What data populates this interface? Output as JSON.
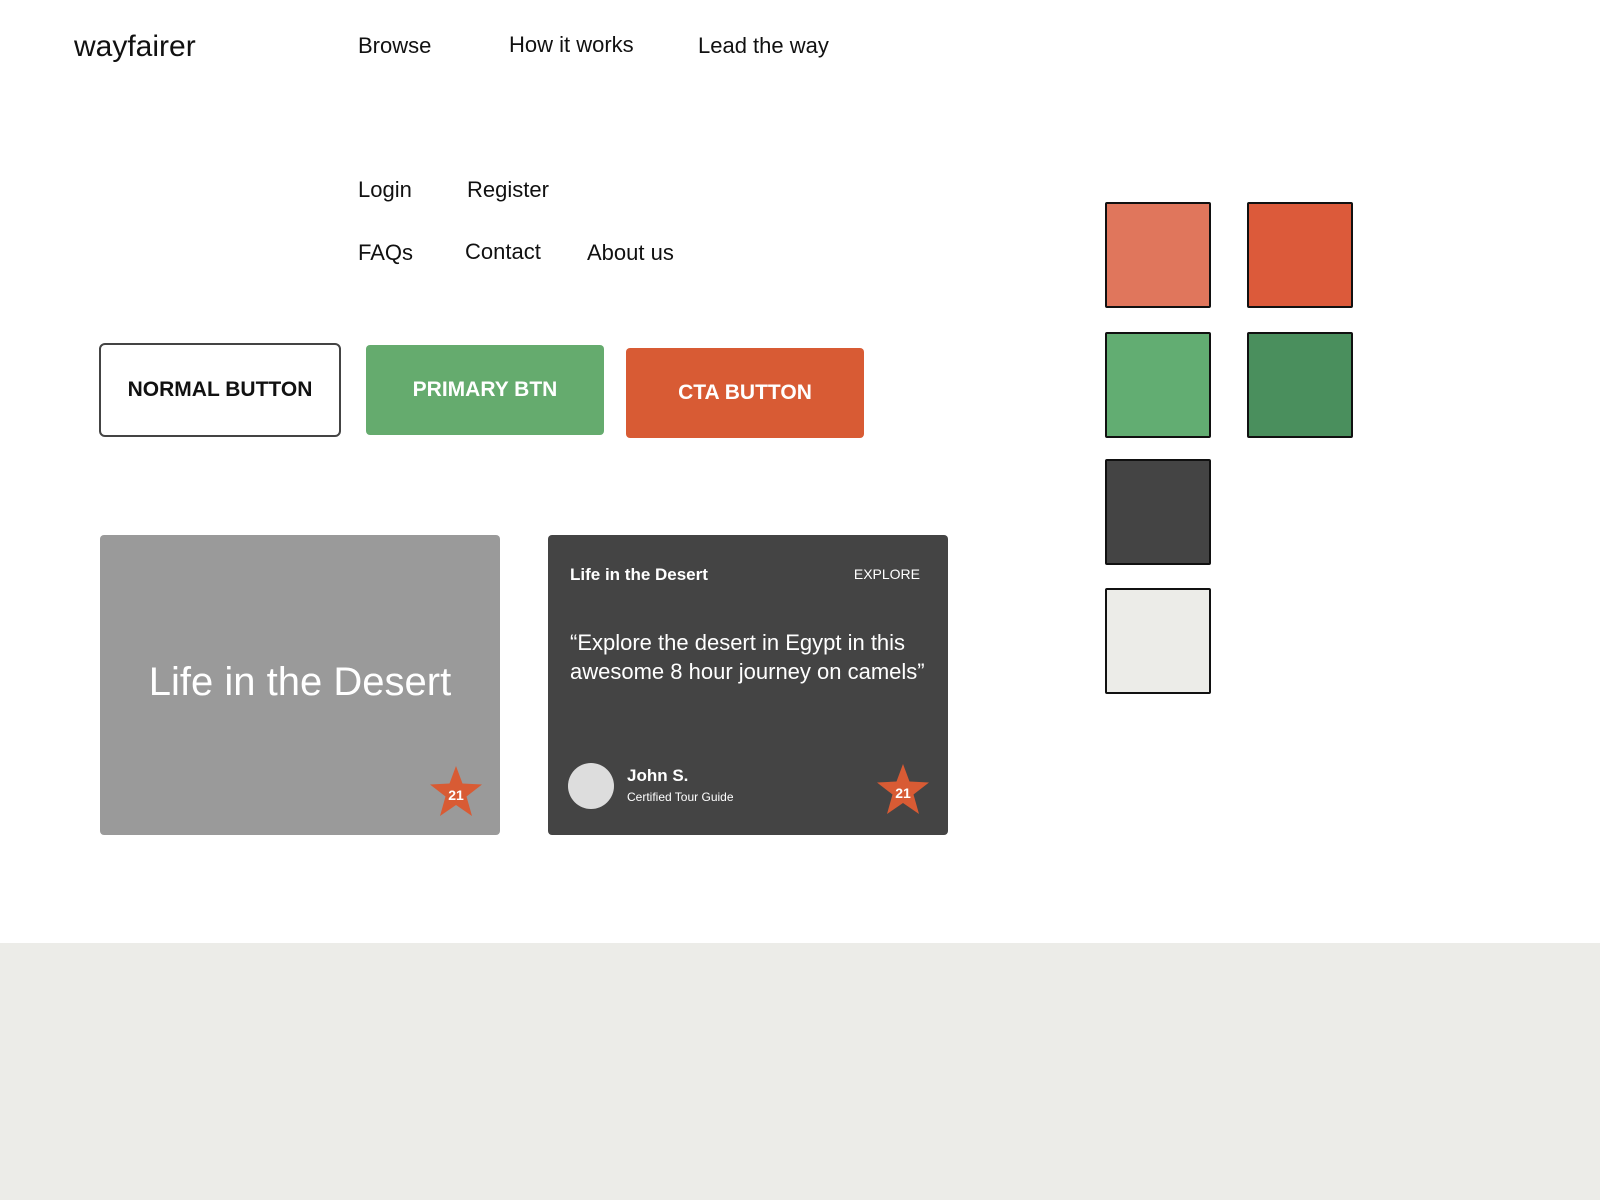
{
  "header": {
    "logo": "wayfairer",
    "nav": [
      {
        "label": "Browse"
      },
      {
        "label": "How it works"
      },
      {
        "label": "Lead the way"
      }
    ]
  },
  "links": {
    "login": "Login",
    "register": "Register",
    "faqs": "FAQs",
    "contact": "Contact",
    "about": "About us"
  },
  "buttons": {
    "normal": "NORMAL BUTTON",
    "primary": "PRIMARY BTN",
    "cta": "CTA BUTTON"
  },
  "card_simple": {
    "title": "Life in the Desert",
    "badge_count": "21"
  },
  "card_detail": {
    "title": "Life in the Desert",
    "action": "EXPLORE",
    "quote": "“Explore the desert in Egypt in this awesome 8 hour journey on camels”",
    "author_name": "John S.",
    "author_role": "Certified Tour Guide",
    "badge_count": "21"
  },
  "colors": {
    "coral_light": "#E0765C",
    "coral": "#DC5A3A",
    "green_light": "#62AD72",
    "green_dark": "#4A8F5D",
    "charcoal": "#444444",
    "off_white": "#ECECE8",
    "card_gray": "#9A9A9A",
    "cta": "#D85B34",
    "primary": "#65AB6E",
    "star": "#D85B34"
  },
  "swatches": [
    {
      "name": "coral-light",
      "color": "#E0765C"
    },
    {
      "name": "coral",
      "color": "#DC5A3A"
    },
    {
      "name": "green-light",
      "color": "#62AD72"
    },
    {
      "name": "green-dark",
      "color": "#4A8F5D"
    },
    {
      "name": "charcoal",
      "color": "#444444"
    },
    {
      "name": "off-white",
      "color": "#ECECE8"
    }
  ]
}
